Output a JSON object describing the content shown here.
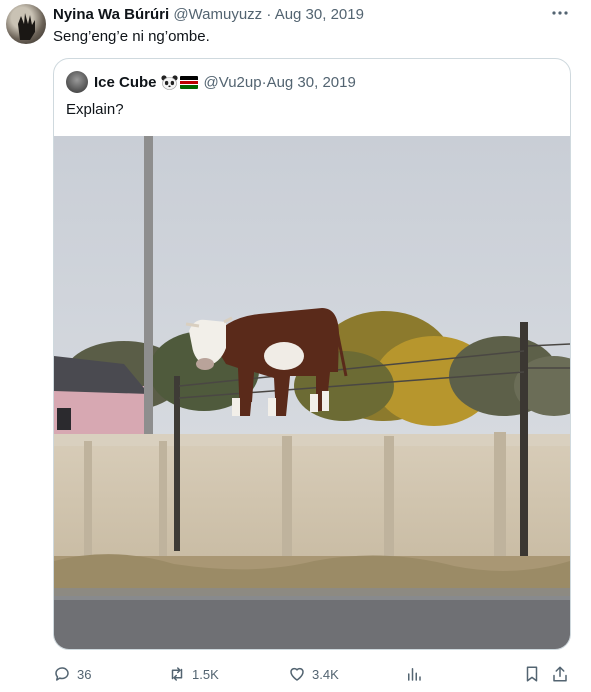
{
  "tweet": {
    "author_name": "Nyina Wa Búrúri",
    "author_handle": "@Wamuyuzz",
    "separator": "·",
    "date": "Aug 30, 2019",
    "text": "Seng’eng’e ni ng’ombe.",
    "more_icon": "more-horizontal-icon"
  },
  "quote": {
    "author_name": "Ice Cube",
    "emojis": [
      "panda-emoji",
      "kenya-flag-emoji"
    ],
    "author_handle": "@Vu2up",
    "separator": "·",
    "date": "Aug 30, 2019",
    "text": "Explain?",
    "image_description_icon": "photo"
  },
  "actions": {
    "replies": "36",
    "retweets": "1.5K",
    "likes": "3.4K",
    "icons": [
      "reply-icon",
      "retweet-icon",
      "like-icon",
      "views-icon",
      "bookmark-icon",
      "share-icon"
    ]
  },
  "colors": {
    "text_primary": "#0f1419",
    "text_secondary": "#536471",
    "border": "#cfd9de"
  }
}
